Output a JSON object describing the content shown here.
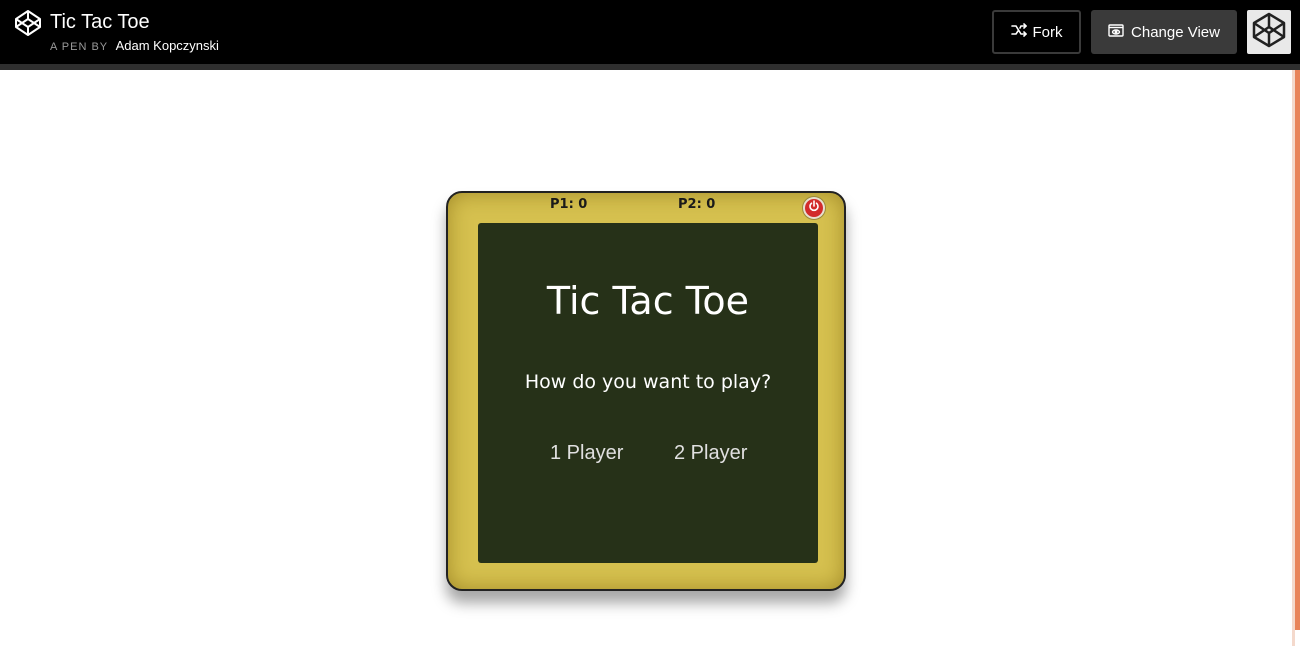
{
  "header": {
    "title": "Tic Tac Toe",
    "by_label": "A PEN BY",
    "author": "Adam Kopczynski",
    "fork_label": "Fork",
    "change_view_label": "Change View",
    "logo_icon": "codepen-logo-icon",
    "avatar_icon": "codepen-avatar-icon"
  },
  "game": {
    "score_p1": "P1: 0",
    "score_p2": "P2: 0",
    "power_icon": "power-icon",
    "title": "Tic Tac Toe",
    "question": "How do you want to play?",
    "option_1": "1 Player",
    "option_2": "2 Player"
  },
  "colors": {
    "frame": "#d6c14f",
    "board": "#263118",
    "power": "#d22b2b",
    "topbar": "#000000"
  }
}
